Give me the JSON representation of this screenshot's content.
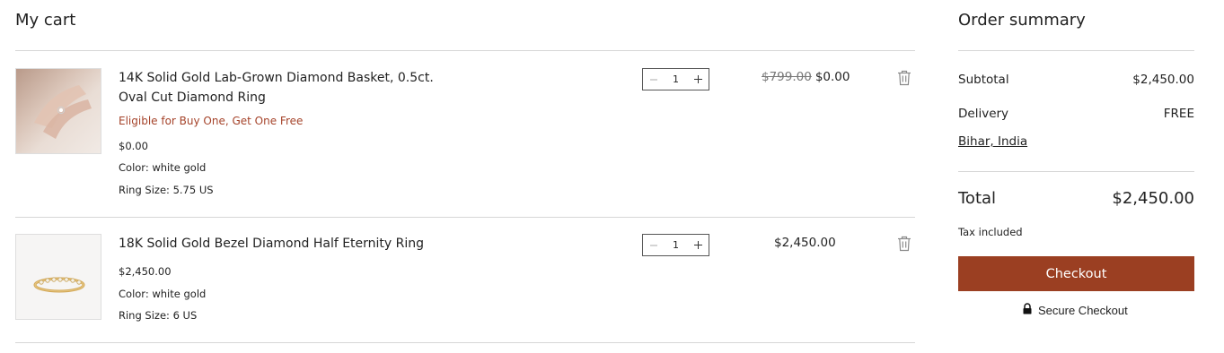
{
  "cart": {
    "title": "My cart",
    "items": [
      {
        "name": "14K Solid Gold Lab-Grown Diamond Basket, 0.5ct. Oval Cut Diamond Ring",
        "promo": "Eligible for Buy One, Get One Free",
        "unit_price": "$0.00",
        "color": "Color: white gold",
        "size": "Ring Size: 5.75 US",
        "quantity": "1",
        "original_price": "$799.00",
        "price": "$0.00"
      },
      {
        "name": "18K Solid Gold Bezel Diamond Half Eternity Ring",
        "unit_price": "$2,450.00",
        "color": "Color: white gold",
        "size": "Ring Size: 6 US",
        "quantity": "1",
        "price": "$2,450.00"
      }
    ]
  },
  "summary": {
    "title": "Order summary",
    "subtotal_label": "Subtotal",
    "subtotal_value": "$2,450.00",
    "delivery_label": "Delivery",
    "delivery_value": "FREE",
    "location": "Bihar, India",
    "total_label": "Total",
    "total_value": "$2,450.00",
    "tax_note": "Tax included",
    "checkout_label": "Checkout",
    "secure_label": "Secure Checkout"
  },
  "icons": {
    "minus": "minus-icon",
    "plus": "plus-icon",
    "trash": "trash-icon",
    "lock": "lock-icon"
  },
  "colors": {
    "accent": "#9b3f22",
    "promo": "#a5432a"
  }
}
